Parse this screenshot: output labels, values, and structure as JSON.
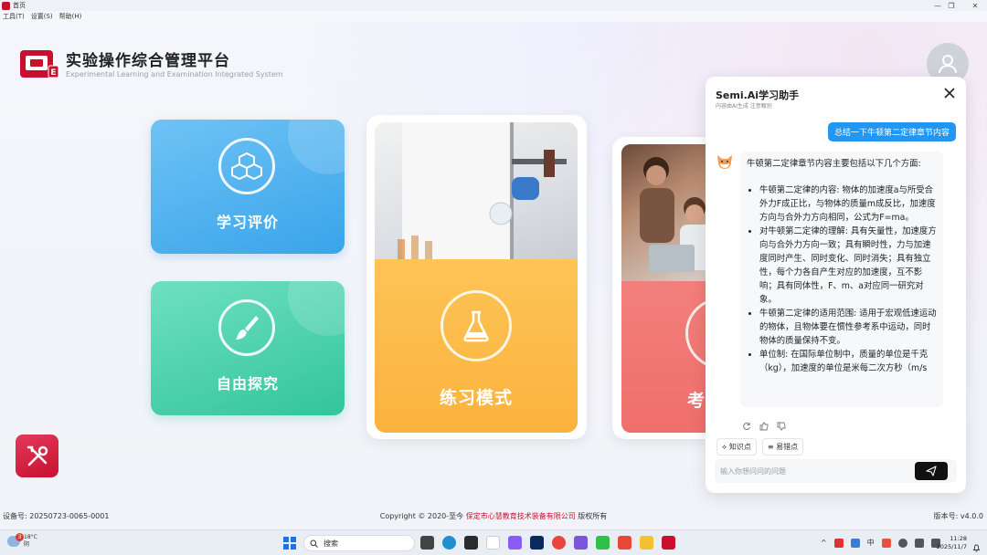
{
  "window": {
    "title": "首页",
    "controls": [
      "—",
      "❐",
      "✕"
    ]
  },
  "menu": {
    "items": [
      "工具(T)",
      "设置(S)",
      "帮助(H)"
    ]
  },
  "brand": {
    "logo_letter": "E",
    "title": "实验操作综合管理平台",
    "subtitle": "Experimental Learning and Examination Integrated System"
  },
  "cards": {
    "learn": "学习评价",
    "free": "自由探究",
    "practice": "练习模式",
    "exam": "考"
  },
  "footer": {
    "device": "设备号: 20250723-0065-0001",
    "copyright_prefix": "Copyright © 2020-至今 ",
    "company": "保定市心慧教育技术装备有限公司",
    "copyright_suffix": " 版权所有",
    "version": "版本号: v4.0.0"
  },
  "assistant": {
    "title": "Semi.Ai学习助手",
    "subtitle": "内容由AI生成 注意甄别",
    "user_message": "总结一下牛顿第二定律章节内容",
    "bot_intro": "牛顿第二定律章节内容主要包括以下几个方面:",
    "bot_points": [
      "牛顿第二定律的内容: 物体的加速度a与所受合外力F成正比，与物体的质量m成反比，加速度方向与合外力方向相同，公式为F=ma。",
      "对牛顿第二定律的理解: 具有矢量性，加速度方向与合外力方向一致；具有瞬时性，力与加速度同时产生、同时变化、同时消失；具有独立性，每个力各自产生对应的加速度，互不影响；具有同体性，F、m、a对应同一研究对象。",
      "牛顿第二定律的适用范围: 适用于宏观低速运动的物体，且物体要在惯性参考系中运动，同时物体的质量保持不变。",
      "单位制: 在国际单位制中，质量的单位是千克（kg），加速度的单位是米每二次方秒（m/s"
    ],
    "chips": [
      "知识点",
      "易错点"
    ],
    "input_placeholder": "输入你想问问的问题"
  },
  "taskbar": {
    "weather_badge": "3",
    "temperature": "18°C",
    "weather_text": "阴",
    "search_label": "搜索",
    "tray_lang": "中",
    "time": "11:28",
    "date": "2025/11/7"
  },
  "colors": {
    "brand_red": "#c8102e",
    "learn_blue": "#39a4ea",
    "free_green": "#32c59c",
    "practice_orange": "#fbb23d",
    "exam_red": "#ef6f6c",
    "user_bubble": "#2196f3"
  }
}
